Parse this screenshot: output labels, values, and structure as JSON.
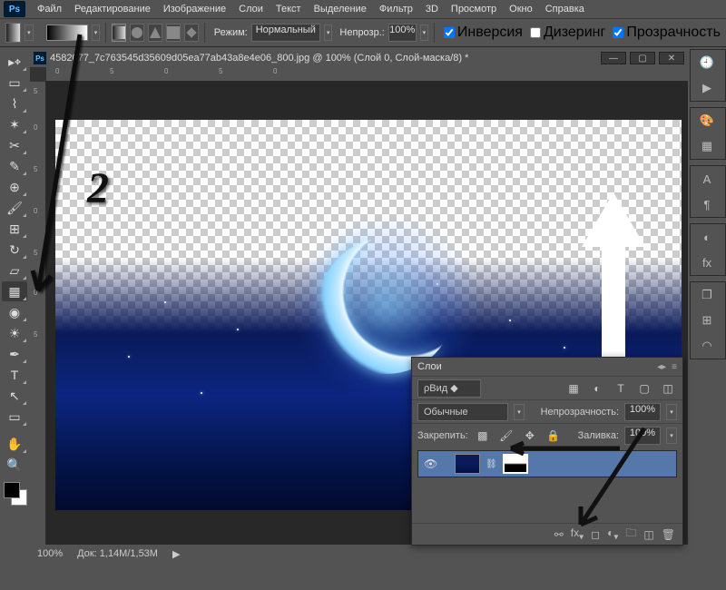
{
  "app": {
    "logo": "Ps"
  },
  "menu": {
    "file": "Файл",
    "edit": "Редактирование",
    "image": "Изображение",
    "layer": "Слои",
    "type": "Текст",
    "select": "Выделение",
    "filter": "Фильтр",
    "threeD": "3D",
    "view": "Просмотр",
    "window": "Окно",
    "help": "Справка"
  },
  "optbar": {
    "mode_label": "Режим:",
    "mode_value": "Нормальный",
    "opacity_label": "Непрозр.:",
    "opacity_value": "100%",
    "reverse": "Инверсия",
    "dither": "Дизеринг",
    "trans": "Прозрачность"
  },
  "doc": {
    "title": "4582077_7c763545d35609d05ea77ab43a8e4e06_800.jpg @ 100% (Слой 0, Слой-маска/8) *"
  },
  "status": {
    "zoom": "100%",
    "doc_label": "Док:",
    "doc_size": "1,14M/1,53M"
  },
  "layers": {
    "title": "Слои",
    "kind": "Вид",
    "blend_mode": "Обычные",
    "opacity_label": "Непрозрачность:",
    "opacity_value": "100%",
    "lock_label": "Закрепить:",
    "fill_label": "Заливка:",
    "fill_value": "100%"
  },
  "annot": {
    "two": "2"
  }
}
